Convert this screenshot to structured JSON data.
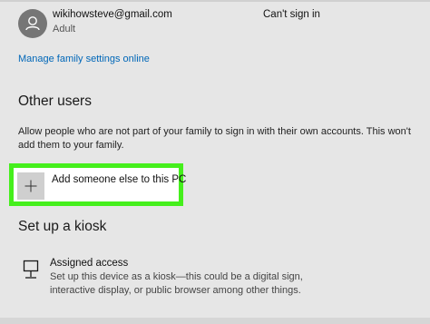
{
  "family_member": {
    "email": "wikihowsteve@gmail.com",
    "role": "Adult",
    "status": "Can't sign in",
    "avatar_icon": "person-icon"
  },
  "manage_link": "Manage family settings online",
  "other_users": {
    "heading": "Other users",
    "description": "Allow people who are not part of your family to sign in with their own accounts. This won't add them to your family.",
    "add_button_label": "Add someone else to this PC",
    "add_icon": "plus-icon",
    "highlight_color": "#45ef1c"
  },
  "kiosk": {
    "heading": "Set up a kiosk",
    "item_title": "Assigned access",
    "item_description": "Set up this device as a kiosk—this could be a digital sign, interactive display, or public browser among other things.",
    "item_icon": "kiosk-icon"
  },
  "colors": {
    "background": "#e6e6e6",
    "link": "#0067b8",
    "avatar": "#767676"
  }
}
